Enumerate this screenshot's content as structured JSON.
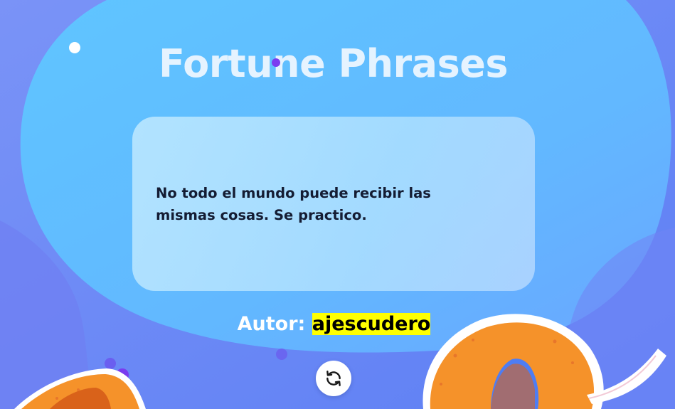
{
  "app": {
    "title": "Fortune Phrases"
  },
  "fortune": {
    "phrase": "No todo el mundo puede recibir las mismas cosas. Se practico.",
    "author_label": "Autor:",
    "author_name": "ajescudero"
  },
  "controls": {
    "refresh_icon": "refresh-icon"
  },
  "colors": {
    "background": "#6a8cf6",
    "blob": "#62bdff",
    "title": "#ecf5ff",
    "card": "#c6ecff",
    "quote_text": "#141c33",
    "author_highlight": "#ffff00",
    "button": "#ffffff",
    "cookie": "#f5922a"
  }
}
